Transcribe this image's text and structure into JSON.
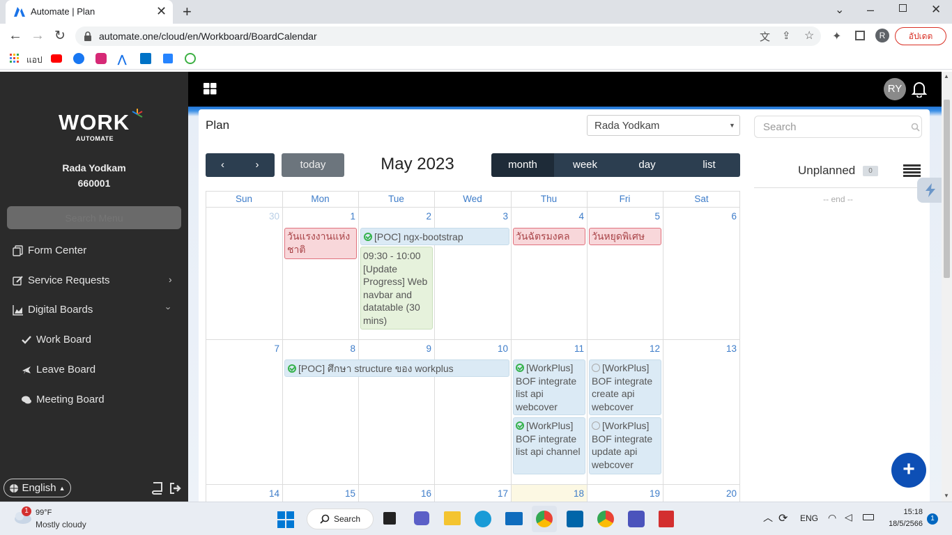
{
  "browser": {
    "tab_title": "Automate | Plan",
    "url": "automate.one/cloud/en/Workboard/BoardCalendar",
    "profile_initial": "R",
    "update_label": "อัปเดต",
    "apps_label": "แอป"
  },
  "sidebar": {
    "logo_main": "WORK",
    "logo_sub": "AUTOMATE",
    "user_name": "Rada Yodkam",
    "user_id": "660001",
    "search_placeholder": "Search Menu",
    "items": [
      {
        "label": "Form Center",
        "icon": "form-icon"
      },
      {
        "label": "Service Requests",
        "icon": "edit-icon"
      },
      {
        "label": "Digital Boards",
        "icon": "chart-icon"
      },
      {
        "label": "Work Board",
        "icon": "check-icon"
      },
      {
        "label": "Leave Board",
        "icon": "plane-icon"
      },
      {
        "label": "Meeting Board",
        "icon": "chat-icon"
      }
    ],
    "language": "English"
  },
  "topbar": {
    "avatar_initials": "RY"
  },
  "plan": {
    "title": "Plan",
    "user_select": "Rada Yodkam",
    "search_placeholder": "Search",
    "unplanned_label": "Unplanned",
    "unplanned_count": "0",
    "end_label": "-- end --"
  },
  "calendar": {
    "today_label": "today",
    "month_title": "May 2023",
    "views": [
      "month",
      "week",
      "day",
      "list"
    ],
    "weekdays": [
      "Sun",
      "Mon",
      "Tue",
      "Wed",
      "Thu",
      "Fri",
      "Sat"
    ],
    "week1": [
      "30",
      "1",
      "2",
      "3",
      "4",
      "5",
      "6"
    ],
    "week2": [
      "7",
      "8",
      "9",
      "10",
      "11",
      "12",
      "13"
    ],
    "week3": [
      "14",
      "15",
      "16",
      "17",
      "18",
      "19",
      "20"
    ],
    "events": {
      "labour_day": "วันแรงงานแห่งชาติ",
      "poc_ngx": "[POC] ngx-bootstrap",
      "update_progress": "09:30 - 10:00 [Update Progress] Web navbar and datatable (30 mins)",
      "coronation": "วันฉัตรมงคล",
      "special_holiday": "วันหยุดพิเศษ",
      "poc_structure": "[POC] ศึกษา structure ของ workplus",
      "bof_list_webcover": "[WorkPlus] BOF integrate list api webcover",
      "bof_list_channel": "[WorkPlus] BOF integrate list api channel",
      "bof_create_webcover": "[WorkPlus] BOF integrate create api webcover",
      "bof_update_webcover": "[WorkPlus] BOF integrate update api webcover"
    }
  },
  "taskbar": {
    "weather_temp": "99°F",
    "weather_desc": "Mostly cloudy",
    "weather_badge": "1",
    "search_label": "Search",
    "lang": "ENG",
    "time": "15:18",
    "date": "18/5/2566",
    "notif_count": "1"
  }
}
